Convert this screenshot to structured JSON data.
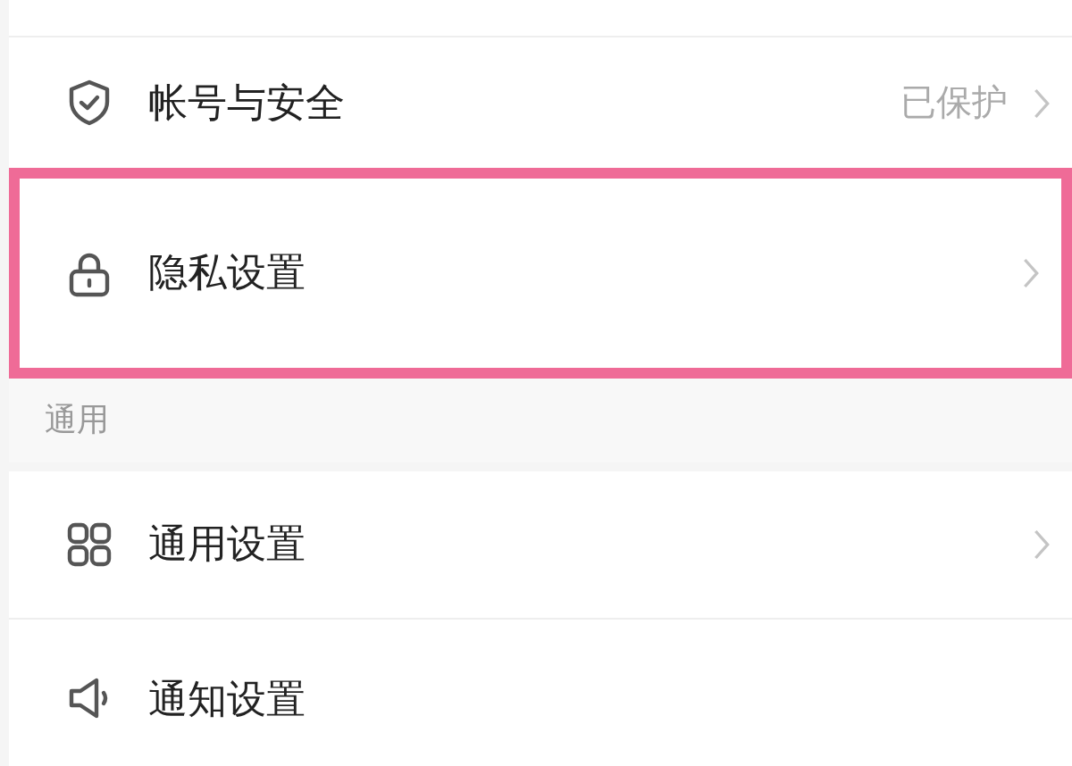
{
  "groups": [
    {
      "items": [
        {
          "label": "帐号与安全",
          "value": "已保护",
          "chevron": true,
          "highlighted": false
        },
        {
          "label": "隐私设置",
          "chevron": true,
          "highlighted": true
        }
      ]
    },
    {
      "header": "通用",
      "items": [
        {
          "label": "通用设置",
          "chevron": true,
          "highlighted": false
        },
        {
          "label": "通知设置",
          "chevron": false,
          "highlighted": false
        }
      ]
    }
  ]
}
